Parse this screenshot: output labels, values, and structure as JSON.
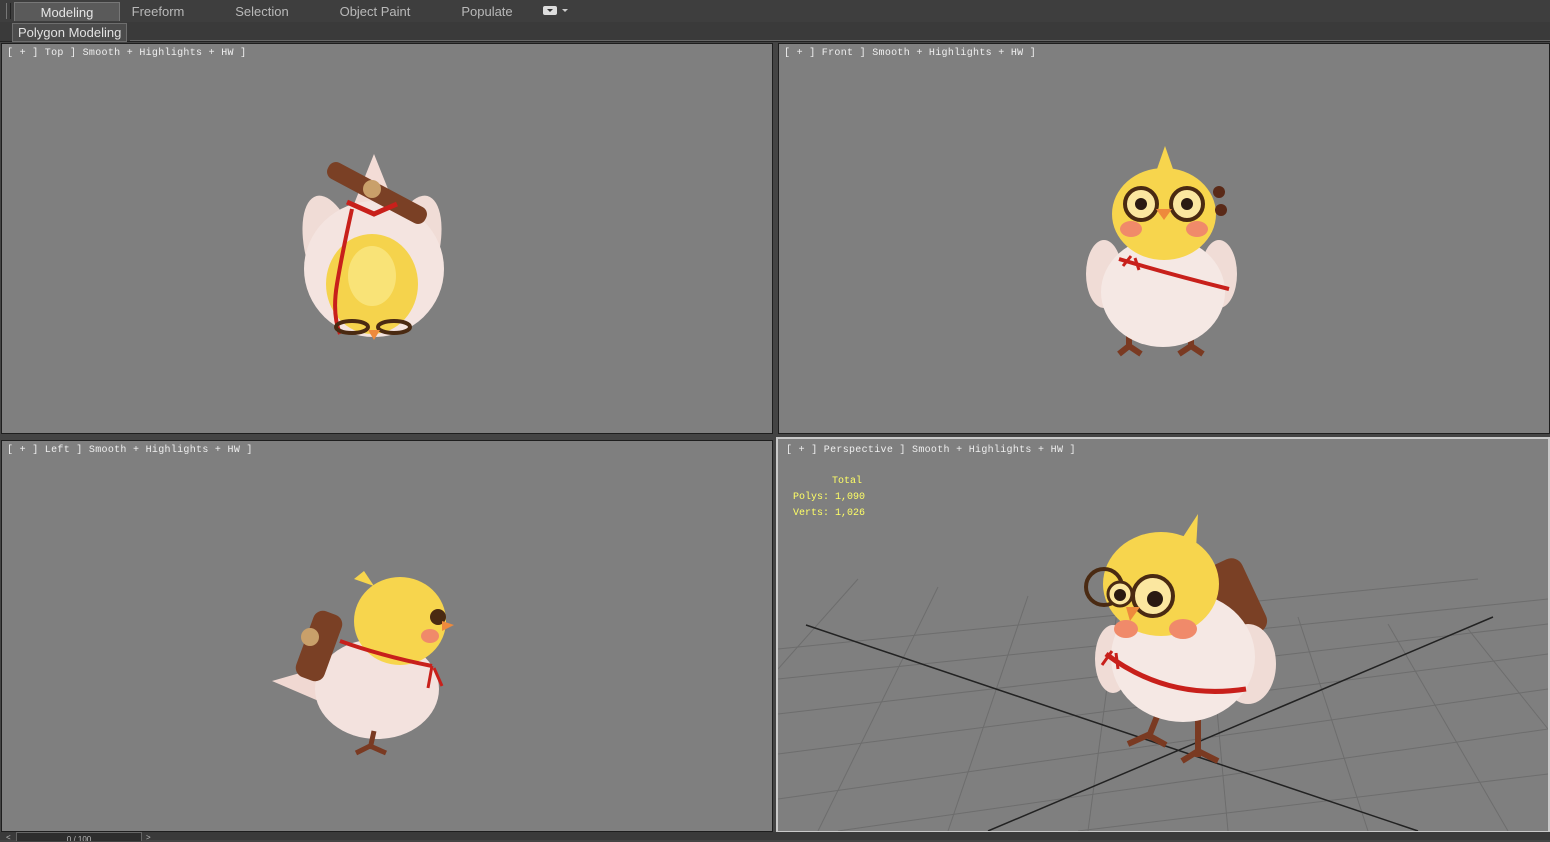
{
  "ribbon": {
    "tabs": [
      {
        "label": "Modeling",
        "active": true
      },
      {
        "label": "Freeform",
        "active": false
      },
      {
        "label": "Selection",
        "active": false
      },
      {
        "label": "Object Paint",
        "active": false
      },
      {
        "label": "Populate",
        "active": false
      }
    ],
    "dropdown_icon": "ribbon-options-icon",
    "sub_tab": "Polygon Modeling"
  },
  "viewports": {
    "top": {
      "label": "[ + ] Top ] Smooth + Highlights + HW ]"
    },
    "front": {
      "label": "[ + ] Front ] Smooth + Highlights + HW ]"
    },
    "left": {
      "label": "[ + ] Left ] Smooth + Highlights + HW ]"
    },
    "perspective": {
      "label": "[ + ] Perspective ] Smooth + Highlights + HW ]",
      "stats": {
        "header": "Total",
        "polys": "Polys: 1,090",
        "verts": "Verts: 1,026"
      }
    }
  },
  "timeline": {
    "frame": "0 / 100"
  },
  "colors": {
    "viewport_bg": "#7f7f7f",
    "stats_text": "#ffff66",
    "ui_bg": "#3e3e3e"
  }
}
